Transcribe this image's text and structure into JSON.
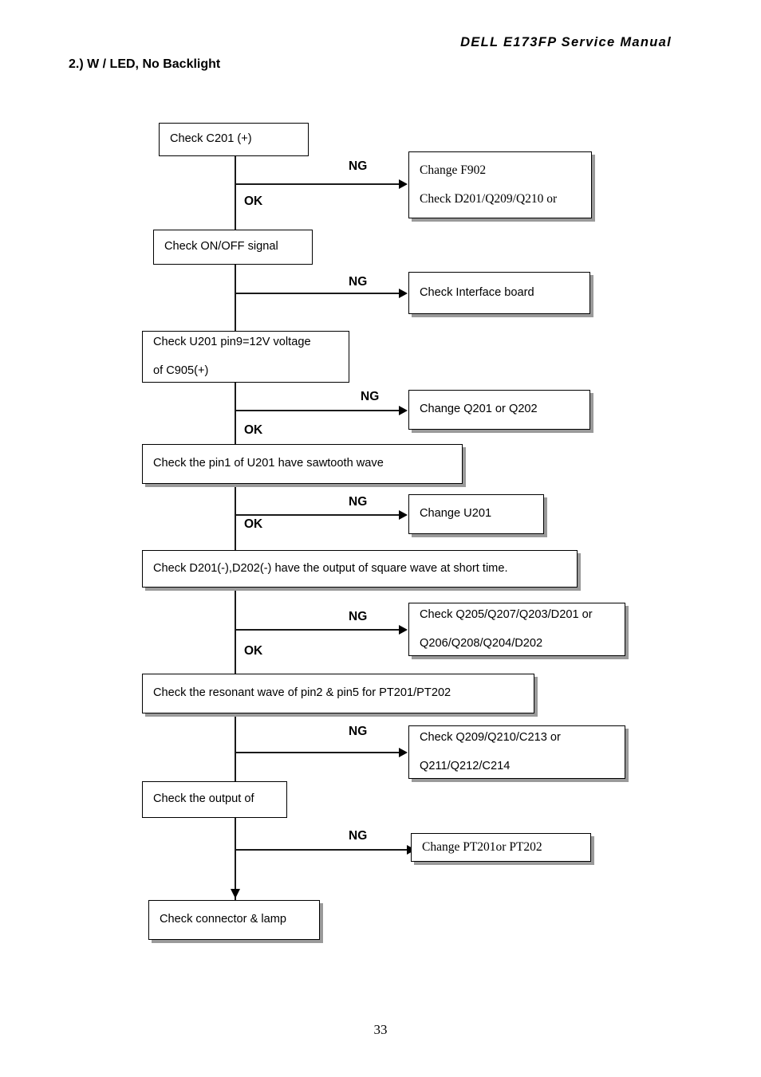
{
  "header": {
    "manual_title": "DELL  E173FP  Service  Manual",
    "section_title": "2.) W / LED, No Backlight",
    "page_number": "33"
  },
  "labels": {
    "ng": "NG",
    "ok": "OK"
  },
  "flow": {
    "nodes": [
      {
        "id": "check-c201",
        "text": "Check C201 (+)"
      },
      {
        "id": "change-f902",
        "line1": "Change F902",
        "line2": "Check D201/Q209/Q210 or"
      },
      {
        "id": "check-onoff",
        "text": "Check ON/OFF signal"
      },
      {
        "id": "check-interface",
        "text": "Check Interface board"
      },
      {
        "id": "check-u201-pin9",
        "line1": "Check U201 pin9=12V voltage",
        "line2": "of C905(+)"
      },
      {
        "id": "change-q201-q202",
        "text": "Change Q201 or Q202"
      },
      {
        "id": "check-pin1-sawtooth",
        "text": "Check the pin1 of U201 have sawtooth wave"
      },
      {
        "id": "change-u201",
        "text": "Change U201"
      },
      {
        "id": "check-d201-d202",
        "text": "Check D201(-),D202(-) have the output of square wave at short time."
      },
      {
        "id": "check-q205-group",
        "line1": "Check Q205/Q207/Q203/D201 or",
        "line2": "Q206/Q208/Q204/D202"
      },
      {
        "id": "check-resonant",
        "text": "Check the resonant wave of pin2 & pin5 for PT201/PT202"
      },
      {
        "id": "check-q209-group",
        "line1": "Check Q209/Q210/C213 or",
        "line2": "Q211/Q212/C214"
      },
      {
        "id": "check-output-of",
        "text": "Check the output of"
      },
      {
        "id": "change-pt201-pt202",
        "text": "Change PT201or PT202"
      },
      {
        "id": "check-connector",
        "text": "Check connector & lamp"
      }
    ],
    "branches": [
      {
        "id": "b1",
        "ng": "NG",
        "ok": "OK"
      },
      {
        "id": "b2",
        "ng": "NG",
        "ok": ""
      },
      {
        "id": "b3",
        "ng": "NG",
        "ok": "OK"
      },
      {
        "id": "b4",
        "ng": "NG",
        "ok": "OK"
      },
      {
        "id": "b5",
        "ng": "NG",
        "ok": "OK"
      },
      {
        "id": "b6",
        "ng": "NG",
        "ok": ""
      },
      {
        "id": "b7",
        "ng": "NG",
        "ok": ""
      }
    ]
  },
  "colors": {
    "line": "#1a1a1a",
    "shadow": "#9a9a9a",
    "background": "#ffffff"
  }
}
